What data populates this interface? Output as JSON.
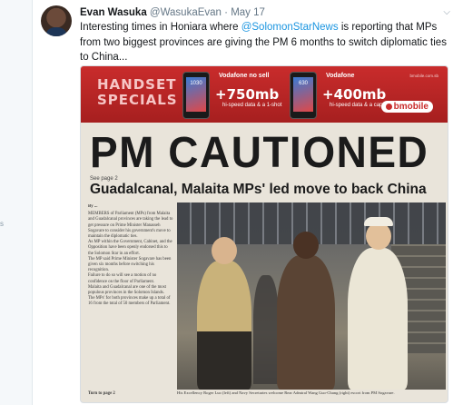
{
  "left_fragment": "s",
  "tweet": {
    "author_name": "Evan Wasuka",
    "handle": "@WasukaEvan",
    "separator": "·",
    "date": "May 17",
    "text_before": "Interesting times in Honiara where ",
    "mention": "@SolomonStarNews",
    "text_after": " is reporting that MPs from two biggest provinces are giving the PM 6 months to switch diplomatic ties to China...",
    "caret_icon": "chevron-down-icon"
  },
  "newspaper": {
    "ad": {
      "title": "HANDSET SPECIALS",
      "phone_left_label": "1030",
      "phone_right_label": "630",
      "carrier_left": "Vodafone no sell",
      "carrier_right": "Vodafone",
      "offer_left": "+750mb",
      "offer_left_sub": "hi-speed data & a 1-shot",
      "offer_right": "+400mb",
      "offer_right_sub": "hi-speed data & a cap",
      "brand": "bmobile",
      "fineprint": "bmobile.com.sb"
    },
    "headline": "PM CAUTIONED",
    "subheadline": "Guadalcanal, Malaita MPs' led move to back China",
    "see_page": "See page 2",
    "byline": "By ...",
    "body_paragraphs": [
      "MEMBERS of Parliament (MPs) from Malaita and Guadalcanal provinces are taking the lead to get pressure on Prime Minister Manasseh Sogavare to consider his government's move to maintain the diplomatic ties.",
      "As MP within the Government, Cabinet, and the Opposition have been openly endorsed this to the Solomon Star in an effort.",
      "The MP said Prime Minister Sogavare has been given six months before switching his recognition.",
      "Failure to do so will see a motion of no confidence on the floor of Parliament.",
      "Malaita and Guadalcanal are one of the most populous provinces in the Solomon Islands.",
      "The MPs' for both provinces make up a total of 16 from the total of 50 members of Parliament."
    ],
    "turn_to_page": "Turn to page 2",
    "caption": "His Excellency Roger Luo (left) and Navy Secretaries welcome Rear Admiral Wang Guo-Chang (right) escort from PM Sogavare."
  }
}
